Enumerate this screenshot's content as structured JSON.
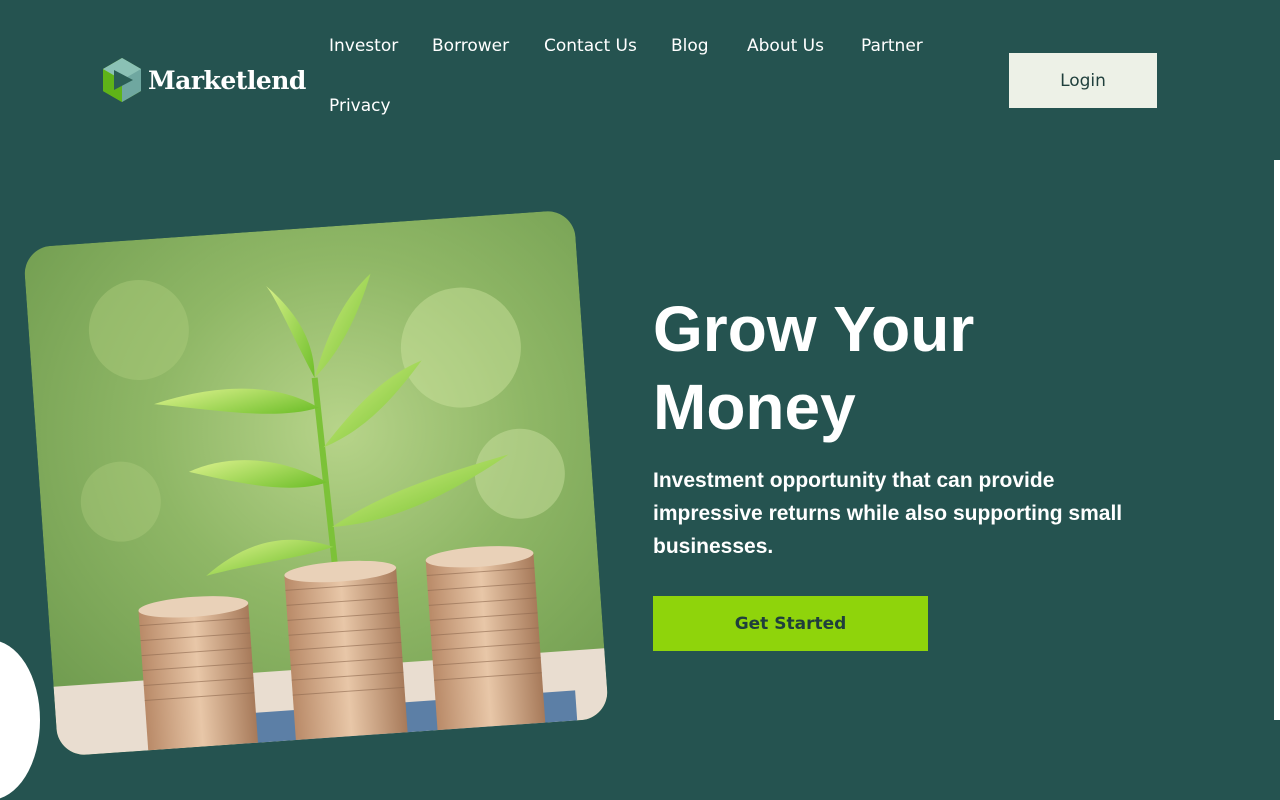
{
  "brand": {
    "name": "Marketlend",
    "colors": {
      "background": "#255350",
      "accent": "#8fd40b",
      "login_bg": "#edf1e7"
    }
  },
  "nav": {
    "items": [
      {
        "label": "Investor"
      },
      {
        "label": "Borrower"
      },
      {
        "label": "Contact Us"
      },
      {
        "label": "Blog"
      },
      {
        "label": "About Us"
      },
      {
        "label": "Partner"
      },
      {
        "label": "Privacy"
      }
    ],
    "login_label": "Login"
  },
  "hero": {
    "title": "Grow Your Money",
    "description": "Investment opportunity that can provide impressive returns while also supporting small businesses.",
    "cta_label": "Get Started",
    "image": "plant-growing-from-coin-stacks"
  }
}
